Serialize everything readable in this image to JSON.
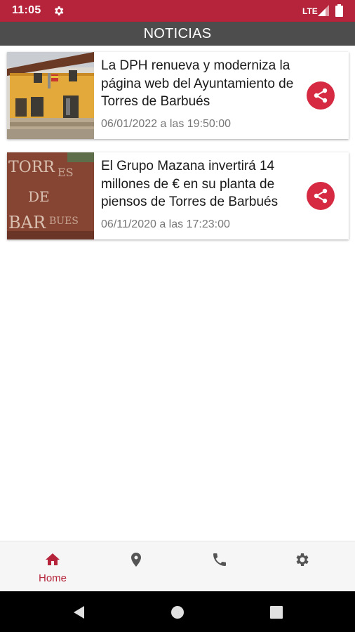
{
  "status_bar": {
    "time": "11:05",
    "network": "LTE",
    "icons": [
      "gear-icon",
      "signal-icon",
      "battery-icon"
    ]
  },
  "header": {
    "title": "NOTICIAS"
  },
  "news": [
    {
      "title": "La DPH renueva y moderniza la página web del Ayuntamiento de Torres de Barbués",
      "date": "06/01/2022 a las 19:50:00",
      "image": "town-hall-photo",
      "share_icon": "share-icon"
    },
    {
      "title": "El Grupo Mazana invertirá 14 millones de € en su planta de piensos de Torres de Barbués",
      "date": "06/11/2020 a las 17:23:00",
      "image": "town-sign-photo",
      "share_icon": "share-icon"
    }
  ],
  "bottom_nav": {
    "items": [
      {
        "id": "home",
        "label": "Home",
        "icon": "home-icon",
        "active": true
      },
      {
        "id": "location",
        "label": "",
        "icon": "location-pin-icon",
        "active": false
      },
      {
        "id": "phone",
        "label": "",
        "icon": "phone-icon",
        "active": false
      },
      {
        "id": "settings",
        "label": "",
        "icon": "settings-icon",
        "active": false
      }
    ]
  },
  "colors": {
    "accent": "#b5243b",
    "header": "#4d4d4d",
    "share": "#d62a43",
    "inactive_icon": "#555555"
  }
}
